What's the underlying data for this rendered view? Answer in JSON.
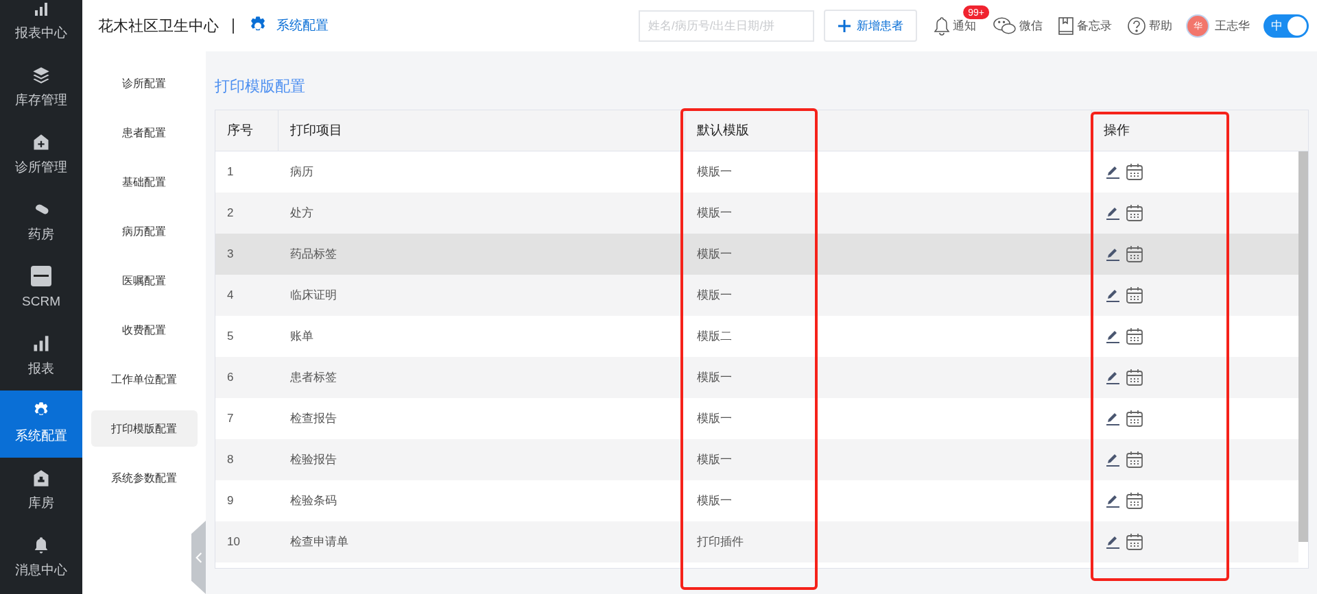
{
  "nav": [
    {
      "label": "报表中心",
      "selected": false
    },
    {
      "label": "库存管理",
      "selected": false
    },
    {
      "label": "诊所管理",
      "selected": false
    },
    {
      "label": "药房",
      "selected": false
    },
    {
      "label": "SCRM",
      "selected": false
    },
    {
      "label": "报表",
      "selected": false
    },
    {
      "label": "系统配置",
      "selected": true
    },
    {
      "label": "库房",
      "selected": false
    },
    {
      "label": "消息中心",
      "selected": false
    }
  ],
  "header": {
    "org": "花木社区卫生中心",
    "section": "系统配置",
    "search": {
      "placeholder": "姓名/病历号/出生日期/拼"
    },
    "new_button": "新增患者",
    "notify": {
      "label": "通知",
      "badge": "99+"
    },
    "wechat": "微信",
    "memo": "备忘录",
    "help": "帮助",
    "user": {
      "avatar": "华",
      "name": "王志华"
    },
    "toggle": {
      "label": "中",
      "on": true
    }
  },
  "subnav": [
    {
      "label": "诊所配置",
      "selected": false
    },
    {
      "label": "患者配置",
      "selected": false
    },
    {
      "label": "基础配置",
      "selected": false
    },
    {
      "label": "病历配置",
      "selected": false
    },
    {
      "label": "医嘱配置",
      "selected": false
    },
    {
      "label": "收费配置",
      "selected": false
    },
    {
      "label": "工作单位配置",
      "selected": false
    },
    {
      "label": "打印模版配置",
      "selected": true
    },
    {
      "label": "系统参数配置",
      "selected": false
    }
  ],
  "page_title": "打印模版配置",
  "table": {
    "columns": [
      {
        "label": "序号",
        "highlighted": false
      },
      {
        "label": "打印项目",
        "highlighted": false
      },
      {
        "label": "默认模版",
        "highlighted": true
      },
      {
        "label": "操作",
        "highlighted": true
      }
    ],
    "rows": [
      {
        "no": "1",
        "item": "病历",
        "template": "模版一",
        "selected": false
      },
      {
        "no": "2",
        "item": "处方",
        "template": "模版一",
        "selected": false
      },
      {
        "no": "3",
        "item": "药品标签",
        "template": "模版一",
        "selected": true
      },
      {
        "no": "4",
        "item": "临床证明",
        "template": "模版一",
        "selected": false
      },
      {
        "no": "5",
        "item": "账单",
        "template": "模版二",
        "selected": false
      },
      {
        "no": "6",
        "item": "患者标签",
        "template": "模版一",
        "selected": false
      },
      {
        "no": "7",
        "item": "检查报告",
        "template": "模版一",
        "selected": false
      },
      {
        "no": "8",
        "item": "检验报告",
        "template": "模版一",
        "selected": false
      },
      {
        "no": "9",
        "item": "检验条码",
        "template": "模版一",
        "selected": false
      },
      {
        "no": "10",
        "item": "检查申请单",
        "template": "打印插件",
        "selected": false
      }
    ]
  }
}
